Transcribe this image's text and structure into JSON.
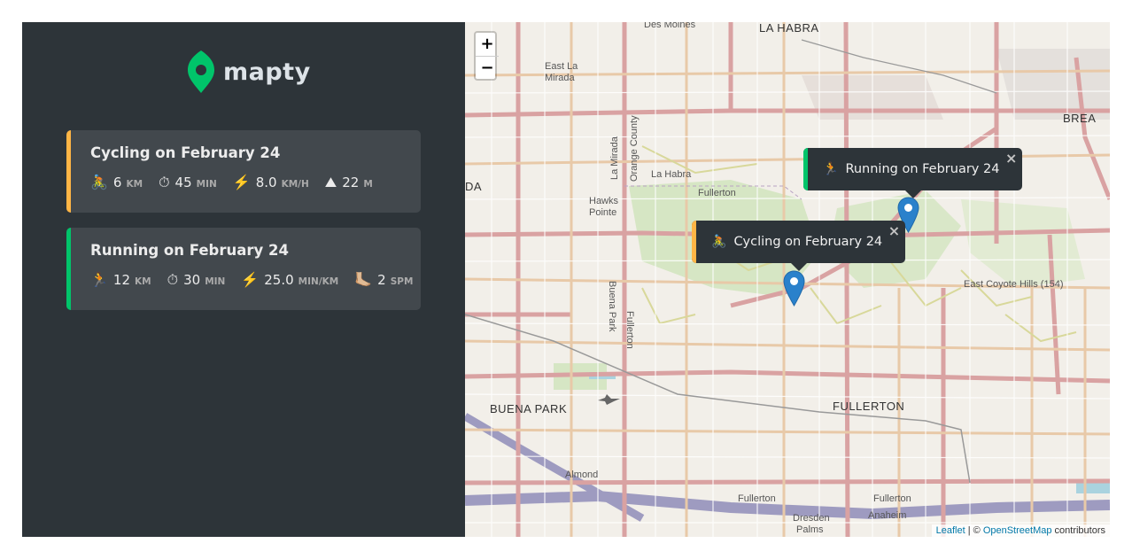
{
  "brand": {
    "name": "mapty",
    "accent": "#00c46a"
  },
  "workouts": [
    {
      "type": "cycling",
      "title": "Cycling on February 24",
      "color": "#ffb545",
      "stats": [
        {
          "icon": "🚴",
          "value": "6",
          "unit": "KM"
        },
        {
          "icon": "⏱",
          "value": "45",
          "unit": "MIN"
        },
        {
          "icon": "⚡️",
          "value": "8.0",
          "unit": "KM/H"
        },
        {
          "icon": "⛰",
          "value": "22",
          "unit": "M"
        }
      ]
    },
    {
      "type": "running",
      "title": "Running on February 24",
      "color": "#00c46a",
      "stats": [
        {
          "icon": "🏃",
          "value": "12",
          "unit": "KM"
        },
        {
          "icon": "⏱",
          "value": "30",
          "unit": "MIN"
        },
        {
          "icon": "⚡️",
          "value": "25.0",
          "unit": "MIN/KM"
        },
        {
          "icon": "🦶🏼",
          "value": "2",
          "unit": "SPM"
        }
      ]
    }
  ],
  "map": {
    "zoom_in": "+",
    "zoom_out": "−",
    "popups": [
      {
        "icon": "🏃",
        "text": "Running on February 24",
        "close": "×"
      },
      {
        "icon": "🚴",
        "text": "Cycling on February 24",
        "close": "×"
      }
    ],
    "labels": {
      "des_moines": "Des Moines",
      "la_habra": "LA HABRA",
      "east_la": "East La",
      "mirada": "Mirada",
      "brea": "BREA",
      "la_habra_small": "La Habra",
      "fullerton_small": "Fullerton",
      "hawks": "Hawks",
      "pointe": "Pointe",
      "orange_county": "Orange County",
      "la_mirada": "La Mirada",
      "buena_park_road": "Buena Park",
      "fullerton_road": "Fullerton",
      "east_coyote": "East Coyote Hills (154)",
      "buena_park": "BUENA PARK",
      "fullerton": "FULLERTON",
      "almond": "Almond",
      "fullerton_b1": "Fullerton",
      "fullerton_b2": "Fullerton",
      "dresden": "Dresden",
      "palms": "Palms",
      "anaheim": "Anaheim",
      "ada": "DA"
    },
    "attribution": {
      "leaflet": "Leaflet",
      "sep": " | © ",
      "osm": "OpenStreetMap",
      "suffix": " contributors"
    }
  }
}
